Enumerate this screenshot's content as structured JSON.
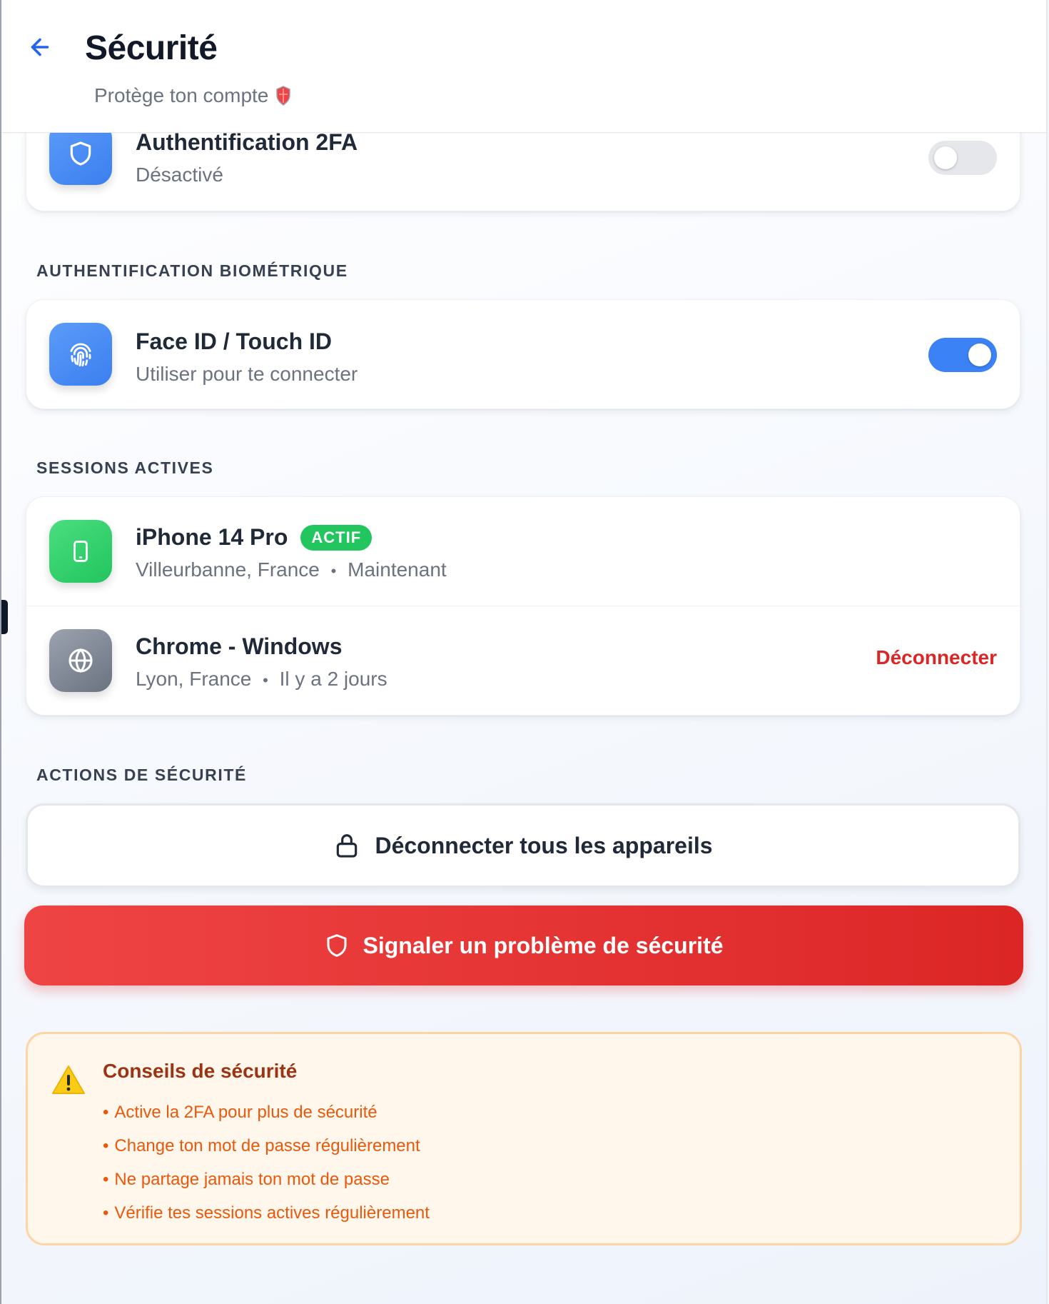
{
  "header": {
    "title": "Sécurité",
    "subtitle": "Protège ton compte",
    "back_icon": "arrow-left-icon",
    "subtitle_icon": "shield-emoji-icon"
  },
  "two_factor": {
    "title": "Authentification 2FA",
    "status": "Désactivé",
    "enabled": false,
    "icon": "shield-icon"
  },
  "biometric": {
    "section_label": "AUTHENTIFICATION BIOMÉTRIQUE",
    "title": "Face ID / Touch ID",
    "subtitle": "Utiliser pour te connecter",
    "enabled": true,
    "icon": "fingerprint-icon"
  },
  "sessions": {
    "section_label": "SESSIONS ACTIVES",
    "items": [
      {
        "device": "iPhone 14 Pro",
        "badge": "ACTIF",
        "location": "Villeurbanne, France",
        "separator": "•",
        "time": "Maintenant",
        "icon": "smartphone-icon"
      },
      {
        "device": "Chrome - Windows",
        "location": "Lyon, France",
        "separator": "•",
        "time": "Il y a 2 jours",
        "action": "Déconnecter",
        "icon": "globe-icon"
      }
    ]
  },
  "actions": {
    "section_label": "ACTIONS DE SÉCURITÉ",
    "logout_all": "Déconnecter tous les appareils",
    "report": "Signaler un problème de sécurité"
  },
  "tips": {
    "title": "Conseils de sécurité",
    "icon": "warning-icon",
    "bullet": "•",
    "items": [
      "Active la 2FA pour plus de sécurité",
      "Change ton mot de passe régulièrement",
      "Ne partage jamais ton mot de passe",
      "Vérifie tes sessions actives régulièrement"
    ]
  },
  "colors": {
    "accent": "#3b82f6",
    "success": "#22c55e",
    "danger": "#dc2626",
    "warning_bg": "#fff6ec",
    "warning_text": "#ea580c"
  }
}
